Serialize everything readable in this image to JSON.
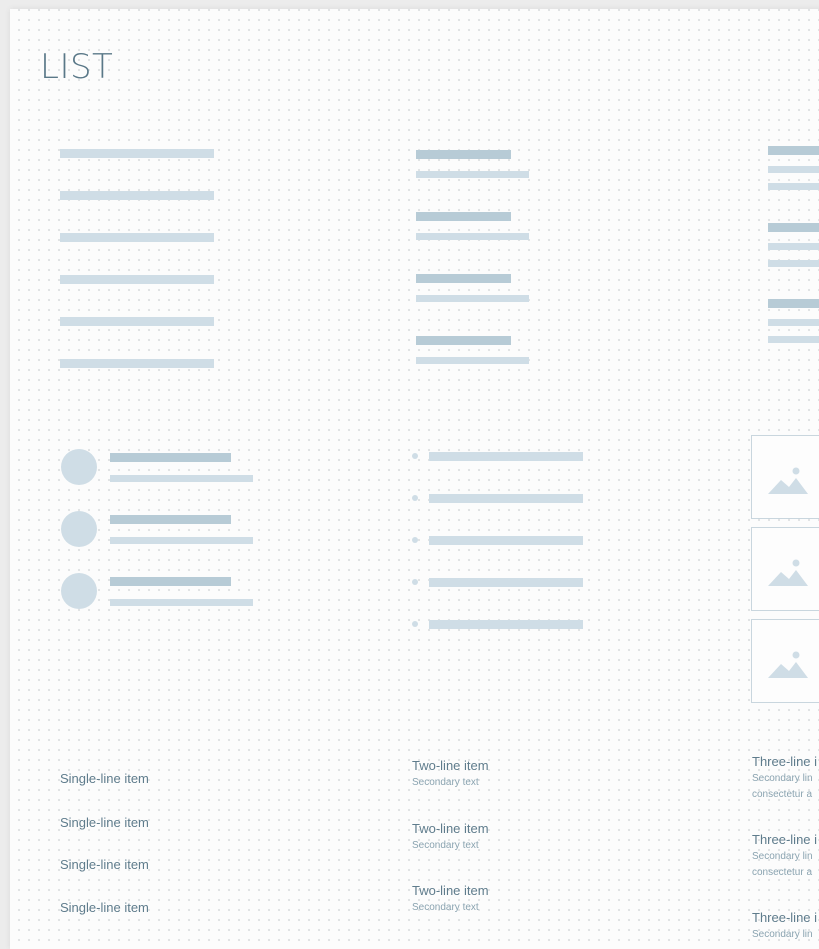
{
  "page": {
    "title": "LIST"
  },
  "colors": {
    "bar_light": "#cfdde6",
    "bar_dark": "#b7cbd6",
    "text": "#5f7c8c",
    "secondary_text": "#8aa3b0"
  },
  "icons": {
    "thumbnail": "image-placeholder-icon"
  },
  "single_line_items": [
    "Single-line item",
    "Single-line item",
    "Single-line item",
    "Single-line item"
  ],
  "two_line_items": [
    {
      "primary": "Two-line item",
      "secondary": "Secondary text"
    },
    {
      "primary": "Two-line item",
      "secondary": "Secondary text"
    },
    {
      "primary": "Two-line item",
      "secondary": "Secondary text"
    }
  ],
  "three_line_items": [
    {
      "primary": "Three-line i",
      "secondary": "Secondary lin",
      "tertiary": "consectetur a"
    },
    {
      "primary": "Three-line i",
      "secondary": "Secondary lin",
      "tertiary": "consectetur a"
    },
    {
      "primary": "Three-line i",
      "secondary": "Secondary lin"
    }
  ]
}
